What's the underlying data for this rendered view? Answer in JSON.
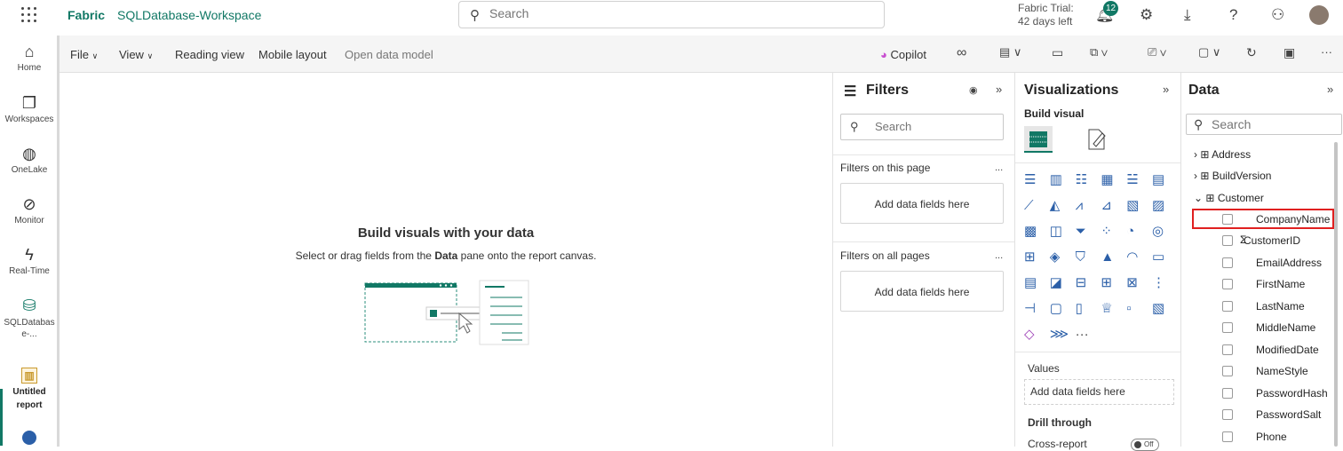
{
  "header": {
    "brand": "Fabric",
    "workspace": "SQLDatabase-Workspace",
    "search_placeholder": "Search",
    "trial_line1": "Fabric Trial:",
    "trial_line2": "42 days left",
    "notifications_count": "12"
  },
  "leftnav": {
    "items": [
      {
        "label": "Home",
        "icon": "home-icon"
      },
      {
        "label": "Workspaces",
        "icon": "workspaces-icon"
      },
      {
        "label": "OneLake",
        "icon": "onelake-icon"
      },
      {
        "label": "Monitor",
        "icon": "monitor-icon"
      },
      {
        "label": "Real-Time",
        "icon": "realtime-icon"
      },
      {
        "label": "SQLDatabas e-...",
        "icon": "sqldatabase-icon"
      },
      {
        "label": "Untitled report",
        "icon": "report-icon"
      }
    ]
  },
  "ribbon": {
    "file": "File",
    "view": "View",
    "reading": "Reading view",
    "mobile": "Mobile layout",
    "model": "Open data model",
    "copilot": "Copilot"
  },
  "canvas": {
    "title": "Build visuals with your data",
    "subtitle_pre": "Select or drag fields from the ",
    "subtitle_bold": "Data",
    "subtitle_post": " pane onto the report canvas."
  },
  "filters": {
    "title": "Filters",
    "search_placeholder": "Search",
    "on_page": "Filters on this page",
    "on_all": "Filters on all pages",
    "add_fields": "Add data fields here",
    "dots": "..."
  },
  "visualizations": {
    "title": "Visualizations",
    "build_visual": "Build visual",
    "values_label": "Values",
    "values_drop": "Add data fields here",
    "drill_label": "Drill through",
    "cross_report": "Cross-report",
    "toggle": "Off"
  },
  "data": {
    "title": "Data",
    "search_placeholder": "Search",
    "tables": [
      "Address",
      "BuildVersion",
      "Customer"
    ],
    "fields": [
      "CompanyName",
      "CustomerID",
      "EmailAddress",
      "FirstName",
      "LastName",
      "MiddleName",
      "ModifiedDate",
      "NameStyle",
      "PasswordHash",
      "PasswordSalt",
      "Phone"
    ]
  }
}
